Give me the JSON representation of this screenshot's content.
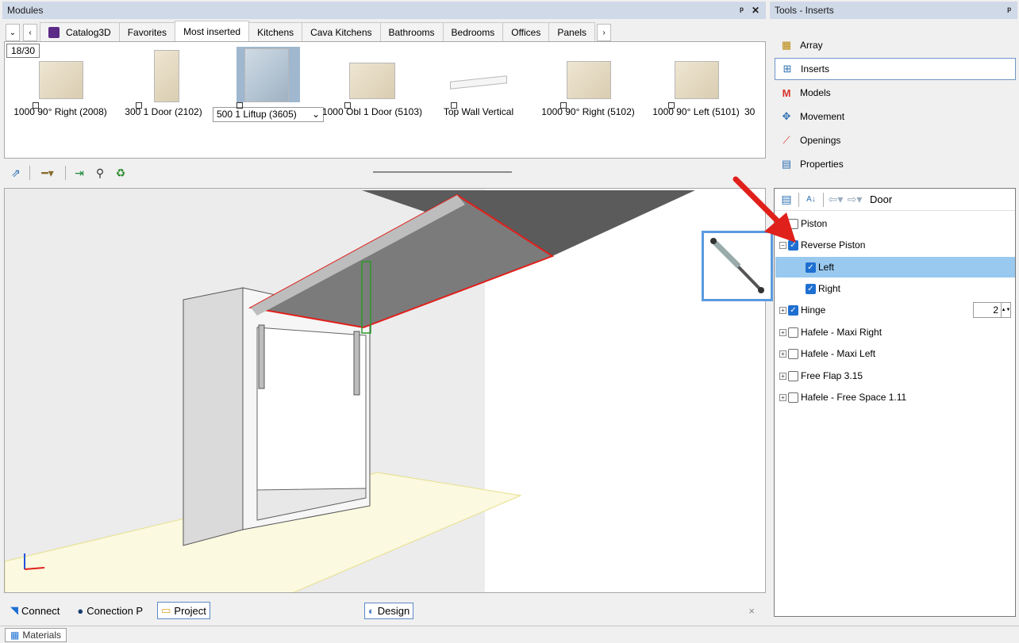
{
  "modules_panel": {
    "title": "Modules",
    "tabs": [
      "Catalog3D",
      "Favorites",
      "Most inserted",
      "Kitchens",
      "Cava Kitchens",
      "Bathrooms",
      "Bedrooms",
      "Offices",
      "Panels"
    ],
    "active_tab": "Most inserted",
    "counter": "18/30",
    "items": [
      {
        "label": "1000 90° Right (2008)"
      },
      {
        "label": "300 1 Door (2102)"
      },
      {
        "label": "500 1 Liftup (3605)"
      },
      {
        "label": "1000 Obl 1 Door (5103)"
      },
      {
        "label": "Top Wall Vertical"
      },
      {
        "label": "1000 90° Right (5102)"
      },
      {
        "label": "1000 90° Left (5101)"
      },
      {
        "label": "30"
      }
    ]
  },
  "bottom_tabs": {
    "connect": "Connect",
    "conection_p": "Conection P",
    "project": "Project",
    "design": "Design",
    "close": "×"
  },
  "status": {
    "materials": "Materials"
  },
  "tools_panel": {
    "title": "Tools - Inserts",
    "items": [
      {
        "label": "Array",
        "icon": "array-icon"
      },
      {
        "label": "Inserts",
        "icon": "inserts-icon"
      },
      {
        "label": "Models",
        "icon": "models-icon"
      },
      {
        "label": "Movement",
        "icon": "movement-icon"
      },
      {
        "label": "Openings",
        "icon": "openings-icon"
      },
      {
        "label": "Properties",
        "icon": "properties-icon"
      }
    ],
    "active_item": "Inserts"
  },
  "property_grid": {
    "breadcrumb": "Door",
    "nodes": [
      {
        "label": "Piston",
        "checked": false
      },
      {
        "label": "Reverse Piston",
        "checked": true
      },
      {
        "label": "Left",
        "checked": true
      },
      {
        "label": "Right",
        "checked": true
      },
      {
        "label": "Hinge",
        "checked": true,
        "value": "2"
      },
      {
        "label": "Hafele - Maxi Right",
        "checked": false
      },
      {
        "label": "Hafele - Maxi Left",
        "checked": false
      },
      {
        "label": "Free Flap 3.15",
        "checked": false
      },
      {
        "label": "Hafele - Free Space 1.11",
        "checked": false
      }
    ]
  },
  "colors": {
    "accent": "#1f6fd1",
    "selection": "#99c9ef",
    "title_bar": "#cfd9e8",
    "annotation": "#e0201b"
  }
}
